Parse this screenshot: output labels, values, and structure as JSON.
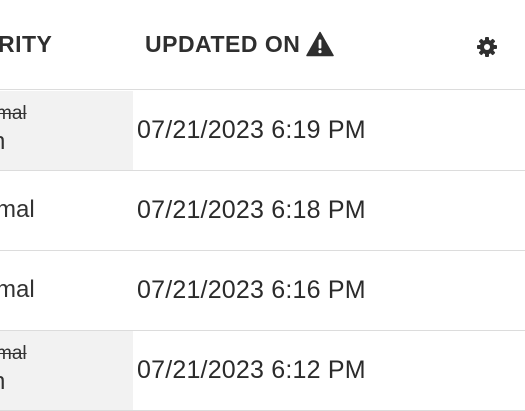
{
  "header": {
    "priority_label": "RITY",
    "updated_on_label": "UPDATED ON",
    "warning_icon": "warning-triangle-icon",
    "settings_icon": "gear-icon"
  },
  "rows": [
    {
      "priority_old": "mal",
      "priority_new": "n",
      "updated_on": "07/21/2023 6:19 PM",
      "changed": true
    },
    {
      "priority": "rmal",
      "updated_on": "07/21/2023 6:18 PM",
      "changed": false
    },
    {
      "priority": "rmal",
      "updated_on": "07/21/2023 6:16 PM",
      "changed": false
    },
    {
      "priority_old": "mal",
      "priority_new": "n",
      "updated_on": "07/21/2023 6:12 PM",
      "changed": true
    }
  ]
}
